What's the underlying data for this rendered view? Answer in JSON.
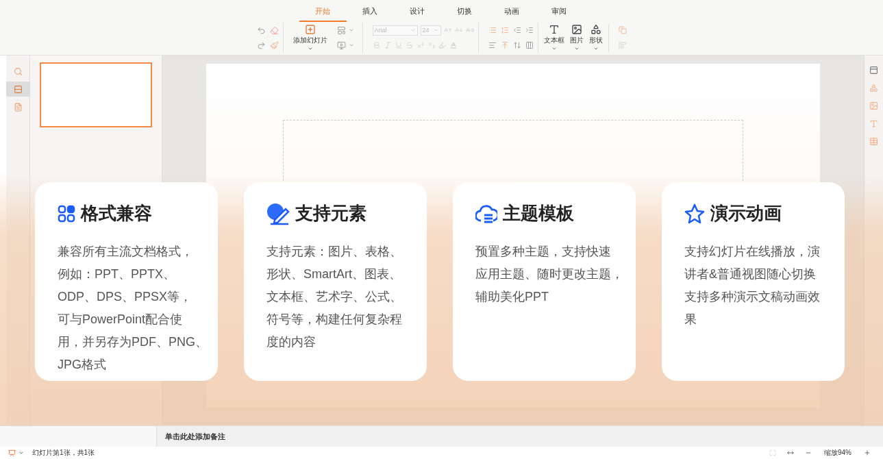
{
  "tabs": [
    {
      "label": "开始",
      "selected": true
    },
    {
      "label": "插入",
      "selected": false
    },
    {
      "label": "设计",
      "selected": false
    },
    {
      "label": "切换",
      "selected": false
    },
    {
      "label": "动画",
      "selected": false
    },
    {
      "label": "审阅",
      "selected": false
    }
  ],
  "toolbar": {
    "add_slide": "添加幻灯片",
    "font": "Arial",
    "font_size": "24",
    "insert_buttons": [
      {
        "kind": "textbox",
        "label": "文本框"
      },
      {
        "kind": "picture",
        "label": "图片"
      },
      {
        "kind": "shape",
        "label": "形状"
      }
    ]
  },
  "left_rail": [
    {
      "kind": "search",
      "selected": false
    },
    {
      "kind": "slides",
      "selected": true
    },
    {
      "kind": "outline",
      "selected": false
    }
  ],
  "thumbnails": [
    {
      "selected": true
    }
  ],
  "notes": {
    "placeholder": "单击此处添加备注"
  },
  "status_bar": {
    "slide_info": "幻灯片第1张，共1张",
    "zoom": "缩放94%"
  },
  "features": [
    {
      "kind": "grid",
      "title": "格式兼容",
      "lines": [
        "兼容所有主流文档格式，",
        "例如：PPT、PPTX、",
        "ODP、DPS、PPSX等，",
        "可与PowerPoint配合使",
        "用，并另存为PDF、PNG、",
        "JPG格式"
      ]
    },
    {
      "kind": "pen",
      "title": "支持元素",
      "lines": [
        "支持元素：图片、表格、",
        "形状、SmartArt、图表、",
        "文本框、艺术字、公式、",
        "符号等，构建任何复杂程",
        "度的内容"
      ]
    },
    {
      "kind": "cloud",
      "title": "主题模板",
      "lines": [
        "预置多种主题，支持快速",
        "应用主题、随时更改主题，",
        "辅助美化PPT"
      ]
    },
    {
      "kind": "star",
      "title": "演示动画",
      "lines": [
        "支持幻灯片在线播放，演",
        "讲者&普通视图随心切换",
        "支持多种演示文稿动画效",
        "果"
      ]
    }
  ]
}
